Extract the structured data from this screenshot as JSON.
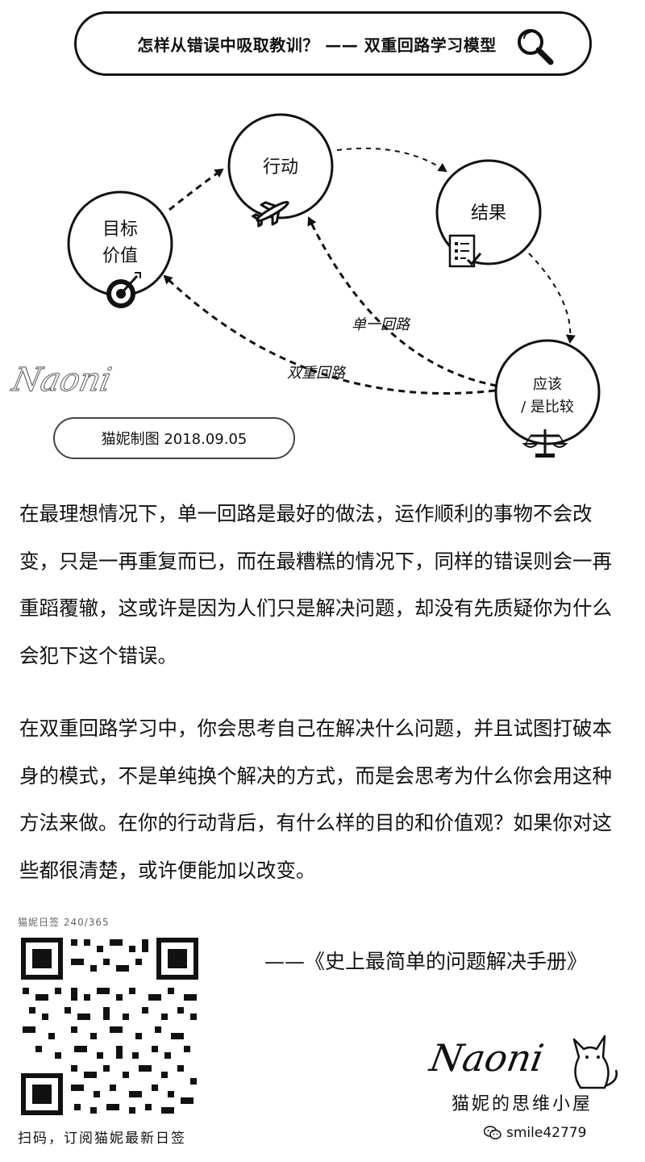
{
  "header": {
    "title": "怎样从错误中吸取教训？ —— 双重回路学习模型",
    "icon": "magnifier-icon"
  },
  "diagram": {
    "nodes": {
      "goal": [
        "目标",
        "价值"
      ],
      "action": "行动",
      "result": "结果",
      "should": [
        "应该",
        "/ 是比较"
      ]
    },
    "paths": {
      "single_loop": "单一回路",
      "double_loop": "双重回路"
    },
    "icons": [
      "target-icon",
      "airplane-icon",
      "checklist-icon",
      "scale-icon"
    ]
  },
  "signature_left": "Naoni",
  "credit": "猫妮制图 2018.09.05",
  "paragraphs": [
    "在最理想情况下，单一回路是最好的做法，运作顺利的事物不会改变，只是一再重复而已，而在最糟糕的情况下，同样的错误则会一再重蹈覆辙，这或许是因为人们只是解决问题，却没有先质疑你为什么会犯下这个错误。",
    "在双重回路学习中，你会思考自己在解决什么问题，并且试图打破本身的模式，不是单纯换个解决的方式，而是会思考为什么你会用这种方法来做。在你的行动背后，有什么样的目的和价值观？如果你对这些都很清楚，或许便能加以改变。"
  ],
  "qr": {
    "top_caption": "猫妮日签 240/365",
    "caption": "扫码，订阅猫妮最新日签"
  },
  "source": "——《史上最简单的问题解决手册》",
  "brand": {
    "signature": "Naoni",
    "name": "猫妮的思维小屋",
    "wechat": "smile42779"
  }
}
